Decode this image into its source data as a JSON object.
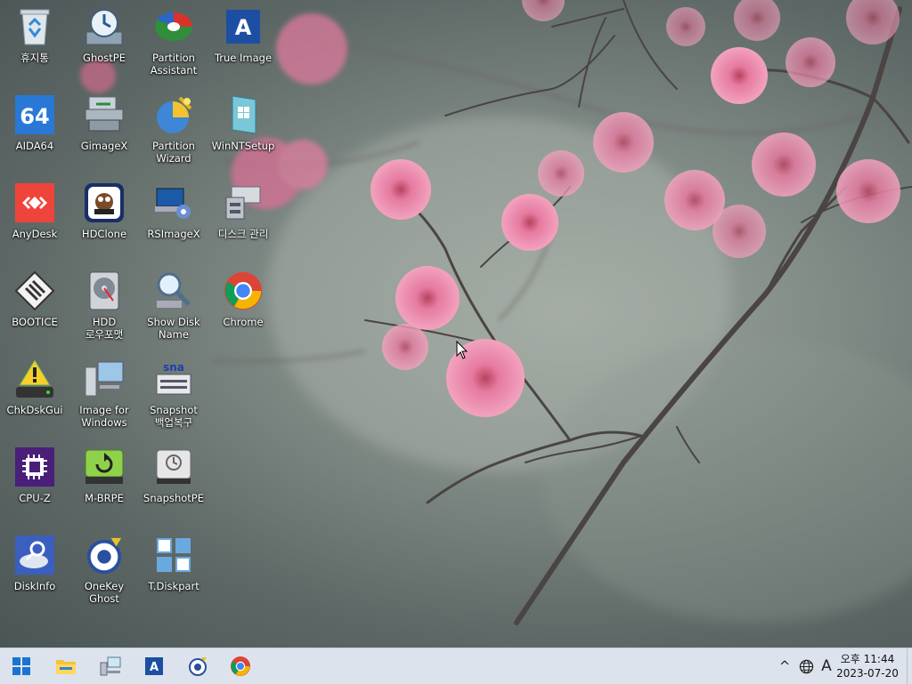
{
  "desktop": {
    "icons": [
      {
        "label": "휴지통",
        "icon": "recycle-bin-icon"
      },
      {
        "label": "GhostPE",
        "icon": "ghost-drive-icon"
      },
      {
        "label": "Partition\nAssistant",
        "icon": "partition-assistant-icon"
      },
      {
        "label": "True Image",
        "icon": "true-image-icon"
      },
      {
        "label": "AIDA64",
        "icon": "aida64-icon"
      },
      {
        "label": "GimageX",
        "icon": "gimagex-icon"
      },
      {
        "label": "Partition\nWizard",
        "icon": "partition-wizard-icon"
      },
      {
        "label": "WinNTSetup",
        "icon": "winntsetup-icon"
      },
      {
        "label": "AnyDesk",
        "icon": "anydesk-icon"
      },
      {
        "label": "HDClone",
        "icon": "hdclone-icon"
      },
      {
        "label": "RSImageX",
        "icon": "rsimagex-icon"
      },
      {
        "label": "디스크 관리",
        "icon": "disk-management-icon"
      },
      {
        "label": "BOOTICE",
        "icon": "bootice-icon"
      },
      {
        "label": "HDD\n로우포맷",
        "icon": "hdd-lowformat-icon"
      },
      {
        "label": "Show Disk\nName",
        "icon": "show-disk-name-icon"
      },
      {
        "label": "Chrome",
        "icon": "chrome-icon"
      },
      {
        "label": "ChkDskGui",
        "icon": "chkdskgui-icon"
      },
      {
        "label": "Image for\nWindows",
        "icon": "image-for-windows-icon"
      },
      {
        "label": "Snapshot\n백업복구",
        "icon": "snapshot-backup-icon"
      },
      {
        "label": "CPU-Z",
        "icon": "cpu-z-icon"
      },
      {
        "label": "M-BRPE",
        "icon": "m-brpe-icon"
      },
      {
        "label": "SnapshotPE",
        "icon": "snapshotpe-icon"
      },
      {
        "label": "DiskInfo",
        "icon": "diskinfo-icon"
      },
      {
        "label": "OneKey\nGhost",
        "icon": "onekey-ghost-icon"
      },
      {
        "label": "T.Diskpart",
        "icon": "t-diskpart-icon"
      }
    ]
  },
  "taskbar": {
    "pinned": [
      "start-icon",
      "file-explorer-icon",
      "network-computer-icon",
      "acronis-icon",
      "onekey-ghost-icon",
      "chrome-icon"
    ],
    "tray": {
      "chevron": "^",
      "ime": "A",
      "time": "오후 11:44",
      "date": "2023-07-20"
    }
  },
  "colors": {
    "taskbar": "#dde3ec",
    "blossom": "#e8709a",
    "branch": "#4a4442"
  }
}
